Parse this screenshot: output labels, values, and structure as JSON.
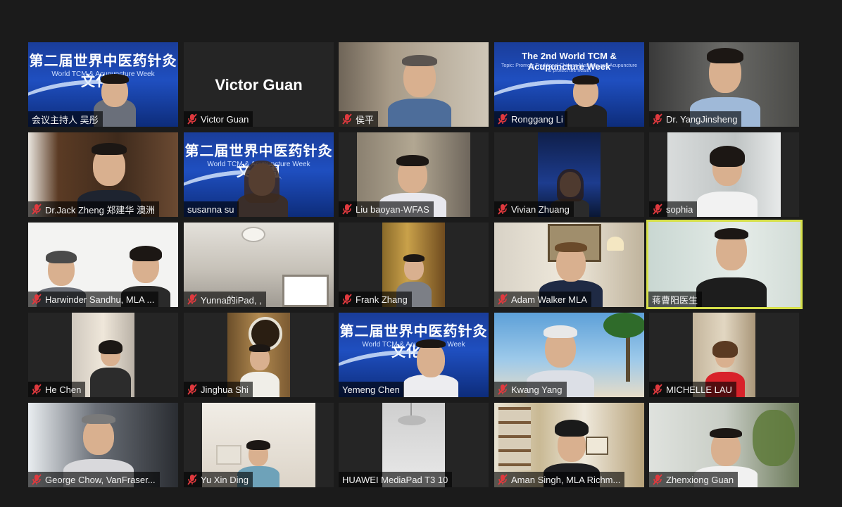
{
  "meeting": {
    "banner_cn": "第二届世界中医药针灸文化周",
    "banner_cn_sub": "World TCM & Acupuncture Week",
    "banner_en": "The 2nd World TCM & Acupuncture Week",
    "banner_en_sub": "Topic: Promote Traditional Chinese Medicine and Acupuncture to protect the health"
  },
  "participants": [
    {
      "name": "会议主持人 吴彤",
      "muted": false,
      "video": "banner_cn"
    },
    {
      "name": "Victor Guan",
      "muted": true,
      "video": "namecard",
      "card_text": "Victor Guan"
    },
    {
      "name": "侯平",
      "muted": true,
      "video": "person"
    },
    {
      "name": "Ronggang Li",
      "muted": true,
      "video": "banner_en"
    },
    {
      "name": "Dr. YangJinsheng",
      "muted": true,
      "video": "person"
    },
    {
      "name": "Dr.Jack Zheng 郑建华 澳洲",
      "muted": true,
      "video": "person"
    },
    {
      "name": "susanna su",
      "muted": false,
      "video": "banner_cn"
    },
    {
      "name": "Liu baoyan-WFAS",
      "muted": true,
      "video": "person"
    },
    {
      "name": "Vivian Zhuang",
      "muted": true,
      "video": "person"
    },
    {
      "name": "sophia",
      "muted": true,
      "video": "person"
    },
    {
      "name": "Harwinder Sandhu, MLA ...",
      "muted": true,
      "video": "person"
    },
    {
      "name": "Yunna的iPad, ,",
      "muted": true,
      "video": "person"
    },
    {
      "name": "Frank Zhang",
      "muted": true,
      "video": "person"
    },
    {
      "name": "Adam Walker MLA",
      "muted": true,
      "video": "person"
    },
    {
      "name": "蒋曹阳医生",
      "muted": false,
      "video": "person",
      "active": true
    },
    {
      "name": "He Chen",
      "muted": true,
      "video": "person"
    },
    {
      "name": "Jinghua Shi",
      "muted": true,
      "video": "person"
    },
    {
      "name": "Yemeng Chen",
      "muted": false,
      "video": "banner_cn"
    },
    {
      "name": "Kwang Yang",
      "muted": true,
      "video": "person"
    },
    {
      "name": "MICHELLE LAU",
      "muted": true,
      "video": "person"
    },
    {
      "name": "George Chow, VanFraser...",
      "muted": true,
      "video": "person"
    },
    {
      "name": "Yu Xin Ding",
      "muted": true,
      "video": "person"
    },
    {
      "name": "HUAWEI MediaPad T3 10",
      "muted": false,
      "video": "room"
    },
    {
      "name": "Aman Singh, MLA Richm...",
      "muted": true,
      "video": "person"
    },
    {
      "name": "Zhenxiong Guan",
      "muted": true,
      "video": "person"
    }
  ],
  "colors": {
    "background": "#1b1b1b",
    "tile": "#252525",
    "active_border": "#d6e04a",
    "muted_icon": "#e0393e"
  }
}
